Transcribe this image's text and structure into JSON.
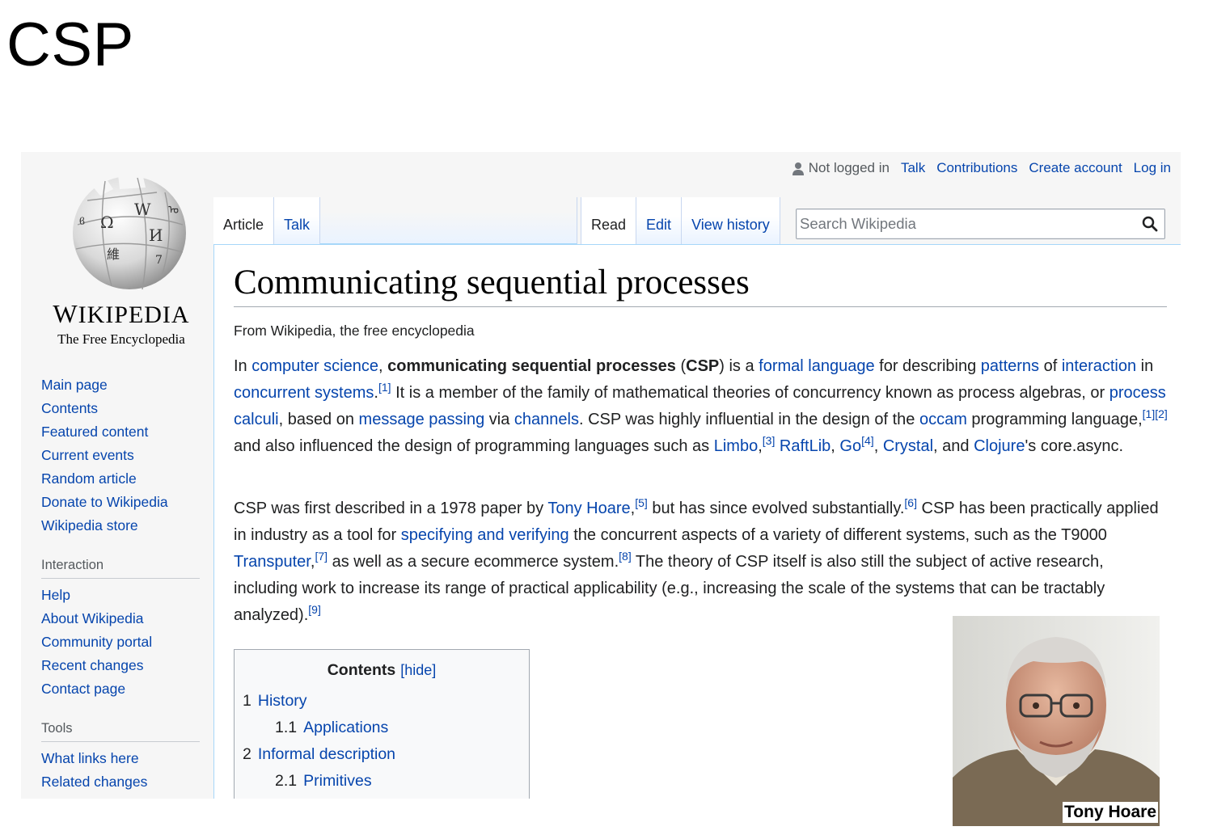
{
  "slide": {
    "title": "CSP"
  },
  "logo": {
    "wordmark_first": "W",
    "wordmark_rest": "IKIPEDIA",
    "tagline": "The Free Encyclopedia"
  },
  "personal": {
    "not_logged_in": "Not logged in",
    "talk": "Talk",
    "contributions": "Contributions",
    "create_account": "Create account",
    "log_in": "Log in"
  },
  "tabs": {
    "article": "Article",
    "talk": "Talk",
    "read": "Read",
    "edit": "Edit",
    "view_history": "View history"
  },
  "search": {
    "placeholder": "Search Wikipedia"
  },
  "sidebar": {
    "navigation": [
      "Main page",
      "Contents",
      "Featured content",
      "Current events",
      "Random article",
      "Donate to Wikipedia",
      "Wikipedia store"
    ],
    "interaction_heading": "Interaction",
    "interaction": [
      "Help",
      "About Wikipedia",
      "Community portal",
      "Recent changes",
      "Contact page"
    ],
    "tools_heading": "Tools",
    "tools": [
      "What links here",
      "Related changes"
    ]
  },
  "article": {
    "title": "Communicating sequential processes",
    "site_sub": "From Wikipedia, the free encyclopedia",
    "p1": [
      {
        "t": "In "
      },
      {
        "t": "computer science",
        "link": true
      },
      {
        "t": ", "
      },
      {
        "t": "communicating sequential processes",
        "bold": true
      },
      {
        "t": " ("
      },
      {
        "t": "CSP",
        "bold": true
      },
      {
        "t": ") is a "
      },
      {
        "t": "formal language",
        "link": true
      },
      {
        "t": " for describing "
      },
      {
        "t": "patterns",
        "link": true
      },
      {
        "t": " of "
      },
      {
        "t": "interaction",
        "link": true
      },
      {
        "t": " in "
      },
      {
        "t": "concurrent systems",
        "link": true
      },
      {
        "t": "."
      },
      {
        "t": "[1]",
        "sup": true
      },
      {
        "t": " It is a member of the family of mathematical theories of concurrency known as process algebras, or "
      },
      {
        "t": "process calculi",
        "link": true
      },
      {
        "t": ", based on "
      },
      {
        "t": "message passing",
        "link": true
      },
      {
        "t": " via "
      },
      {
        "t": "channels",
        "link": true
      },
      {
        "t": ". CSP was highly influential in the design of the "
      },
      {
        "t": "occam",
        "link": true
      },
      {
        "t": " programming language,"
      },
      {
        "t": "[1]",
        "sup": true
      },
      {
        "t": "[2]",
        "sup": true
      },
      {
        "t": " and also influenced the design of programming languages such as "
      },
      {
        "t": "Limbo",
        "link": true
      },
      {
        "t": ","
      },
      {
        "t": "[3]",
        "sup": true
      },
      {
        "t": " "
      },
      {
        "t": "RaftLib",
        "link": true
      },
      {
        "t": ", "
      },
      {
        "t": "Go",
        "link": true
      },
      {
        "t": "[4]",
        "sup": true
      },
      {
        "t": ", "
      },
      {
        "t": "Crystal",
        "link": true
      },
      {
        "t": ", and "
      },
      {
        "t": "Clojure",
        "link": true
      },
      {
        "t": "'s core.async."
      }
    ],
    "p2": [
      {
        "t": "CSP was first described in a 1978 paper by "
      },
      {
        "t": "Tony Hoare",
        "link": true
      },
      {
        "t": ","
      },
      {
        "t": "[5]",
        "sup": true
      },
      {
        "t": " but has since evolved substantially."
      },
      {
        "t": "[6]",
        "sup": true
      },
      {
        "t": " CSP has been practically applied in industry as a tool for "
      },
      {
        "t": "specifying and verifying",
        "link": true
      },
      {
        "t": " the concurrent aspects of a variety of different systems, such as the T9000 "
      },
      {
        "t": "Transputer",
        "link": true
      },
      {
        "t": ","
      },
      {
        "t": "[7]",
        "sup": true
      },
      {
        "t": " as well as a secure ecommerce system."
      },
      {
        "t": "[8]",
        "sup": true
      },
      {
        "t": " The theory of CSP itself is also still the subject of active research, including work to increase its range of practical applicability (e.g., increasing the scale of the systems that can be tractably analyzed)."
      },
      {
        "t": "[9]",
        "sup": true
      }
    ]
  },
  "toc": {
    "title": "Contents",
    "toggle": "[hide]",
    "items": [
      {
        "num": "1",
        "label": "History",
        "level": 1
      },
      {
        "num": "1.1",
        "label": "Applications",
        "level": 2
      },
      {
        "num": "2",
        "label": "Informal description",
        "level": 1
      },
      {
        "num": "2.1",
        "label": "Primitives",
        "level": 2
      }
    ]
  },
  "photo": {
    "caption": "Tony Hoare"
  },
  "colors": {
    "link": "#0645ad",
    "text": "#202122",
    "border": "#a7d7f9",
    "sidebar_bg": "#f6f6f6"
  }
}
